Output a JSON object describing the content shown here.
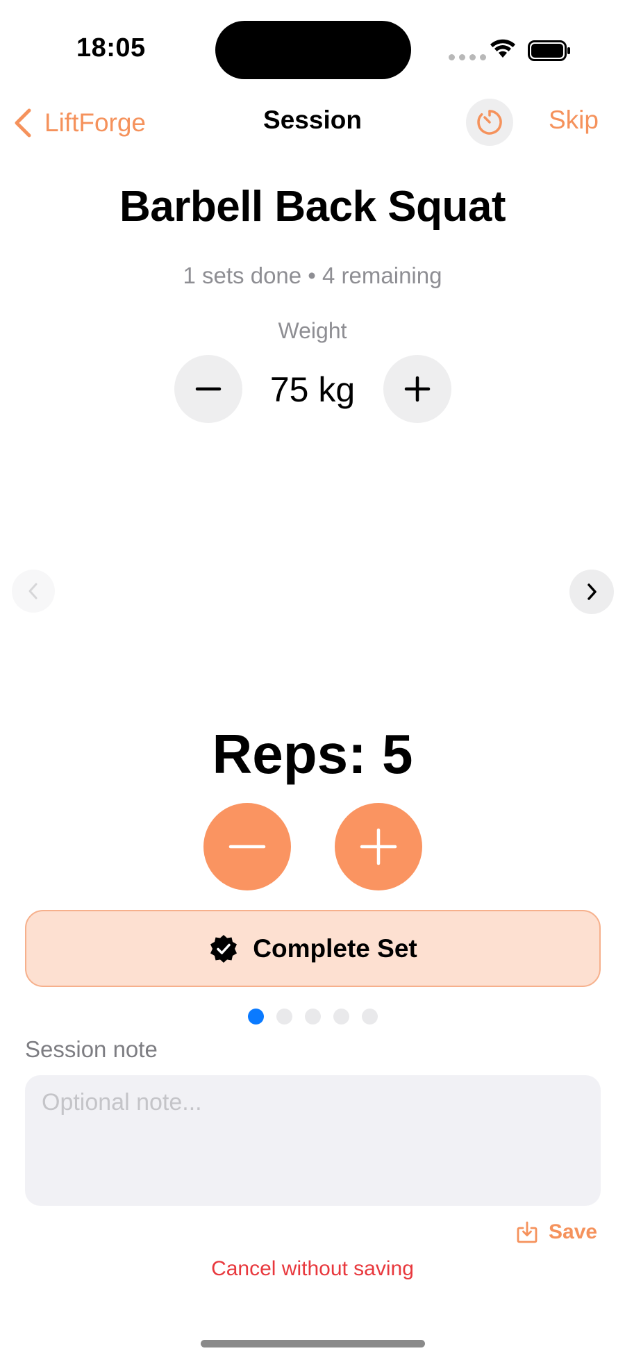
{
  "status_bar": {
    "time": "18:05",
    "signal_icon": "cellular-dots-icon",
    "wifi_icon": "wifi-icon",
    "battery_icon": "battery-icon"
  },
  "nav": {
    "back_label": "LiftForge",
    "back_icon": "chevron-left-icon",
    "title": "Session",
    "timer_icon": "timer-icon",
    "skip_label": "Skip"
  },
  "exercise": {
    "name": "Barbell Back Squat",
    "sets_info": "1 sets done • 4 remaining",
    "weight_label": "Weight",
    "weight_value": "75 kg",
    "reps_label": "Reps: 5"
  },
  "actions": {
    "complete_set_label": "Complete Set",
    "complete_icon": "checkmark-seal-icon"
  },
  "pager": {
    "total": 5,
    "active_index": 0
  },
  "note": {
    "label": "Session note",
    "placeholder": "Optional note...",
    "value": ""
  },
  "footer": {
    "save_label": "Save",
    "save_icon": "download-tray-icon",
    "cancel_label": "Cancel without saving"
  },
  "colors": {
    "accent": "#f5925c",
    "accent_fill": "#fa9461",
    "complete_bg": "#fde0d1",
    "destructive": "#e8383d",
    "page_dot_active": "#0a7aff"
  }
}
